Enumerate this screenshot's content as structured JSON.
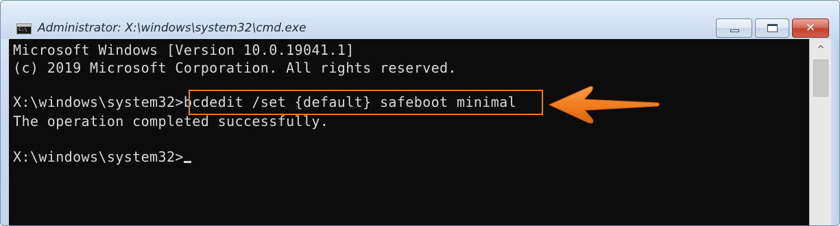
{
  "window": {
    "title": "Administrator: X:\\windows\\system32\\cmd.exe",
    "icon": "cmd-icon",
    "icon_text": "C:\\",
    "controls": {
      "minimize_icon": "minimize-icon",
      "maximize_icon": "maximize-icon",
      "close_icon": "close-icon",
      "close_glyph": "✕"
    }
  },
  "console": {
    "lines": [
      "Microsoft Windows [Version 10.0.19041.1]",
      "(c) 2019 Microsoft Corporation. All rights reserved.",
      "",
      "X:\\windows\\system32>bcdedit /set {default} safeboot minimal",
      "The operation completed successfully.",
      "",
      "X:\\windows\\system32>"
    ],
    "prompt": "X:\\windows\\system32>",
    "highlighted_command": "bcdedit /set {default} safeboot minimal",
    "result": "The operation completed successfully."
  },
  "annotation": {
    "highlight_color": "#f07d1f",
    "arrow_color": "#f07d1f",
    "arrow_icon": "left-arrow-icon"
  },
  "scrollbar": {
    "up_glyph": "^"
  },
  "colors": {
    "console_bg": "#0c0c0c",
    "console_text": "#d9d9d9",
    "close_button": "#c2412c"
  }
}
